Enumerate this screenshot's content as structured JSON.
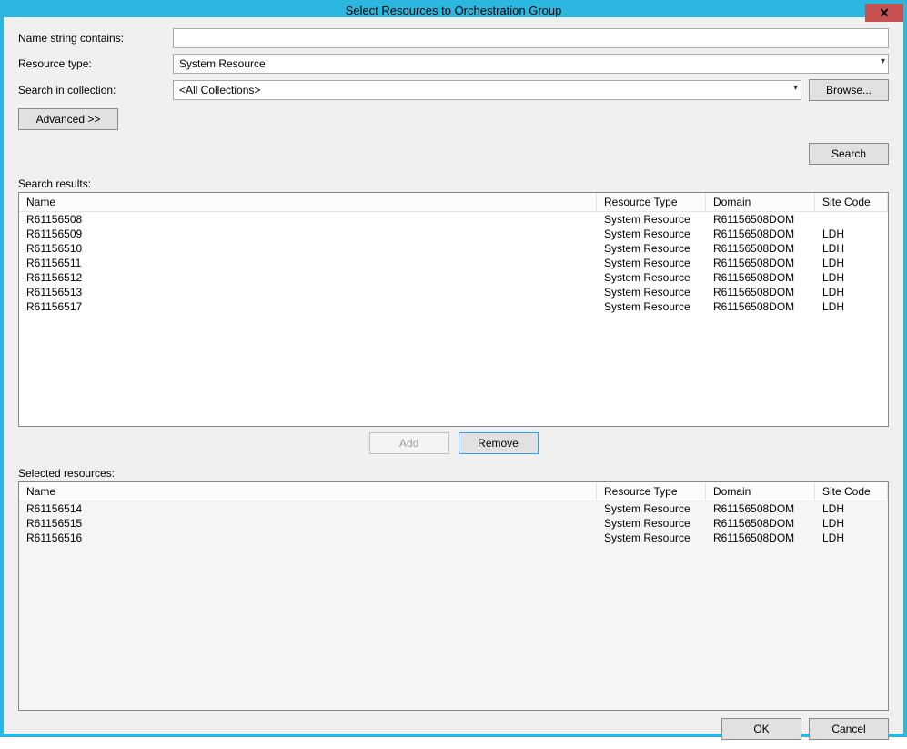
{
  "window": {
    "title": "Select Resources to Orchestration Group"
  },
  "form": {
    "name_label": "Name string contains:",
    "name_value": "",
    "type_label": "Resource type:",
    "type_value": "System Resource",
    "collection_label": "Search in collection:",
    "collection_value": "<All Collections>",
    "browse_label": "Browse...",
    "advanced_label": "Advanced >>",
    "search_label": "Search"
  },
  "results": {
    "label": "Search results:",
    "columns": {
      "name": "Name",
      "type": "Resource Type",
      "domain": "Domain",
      "site": "Site Code"
    },
    "rows": [
      {
        "name": "R61156508",
        "type": "System Resource",
        "domain": "R61156508DOM",
        "site": ""
      },
      {
        "name": "R61156509",
        "type": "System Resource",
        "domain": "R61156508DOM",
        "site": "LDH"
      },
      {
        "name": "R61156510",
        "type": "System Resource",
        "domain": "R61156508DOM",
        "site": "LDH"
      },
      {
        "name": "R61156511",
        "type": "System Resource",
        "domain": "R61156508DOM",
        "site": "LDH"
      },
      {
        "name": "R61156512",
        "type": "System Resource",
        "domain": "R61156508DOM",
        "site": "LDH"
      },
      {
        "name": "R61156513",
        "type": "System Resource",
        "domain": "R61156508DOM",
        "site": "LDH"
      },
      {
        "name": "R61156517",
        "type": "System Resource",
        "domain": "R61156508DOM",
        "site": "LDH"
      }
    ]
  },
  "actions": {
    "add": "Add",
    "remove": "Remove"
  },
  "selected": {
    "label": "Selected resources:",
    "columns": {
      "name": "Name",
      "type": "Resource Type",
      "domain": "Domain",
      "site": "Site Code"
    },
    "rows": [
      {
        "name": "R61156514",
        "type": "System Resource",
        "domain": "R61156508DOM",
        "site": "LDH"
      },
      {
        "name": "R61156515",
        "type": "System Resource",
        "domain": "R61156508DOM",
        "site": "LDH"
      },
      {
        "name": "R61156516",
        "type": "System Resource",
        "domain": "R61156508DOM",
        "site": "LDH"
      }
    ]
  },
  "footer": {
    "ok": "OK",
    "cancel": "Cancel"
  }
}
